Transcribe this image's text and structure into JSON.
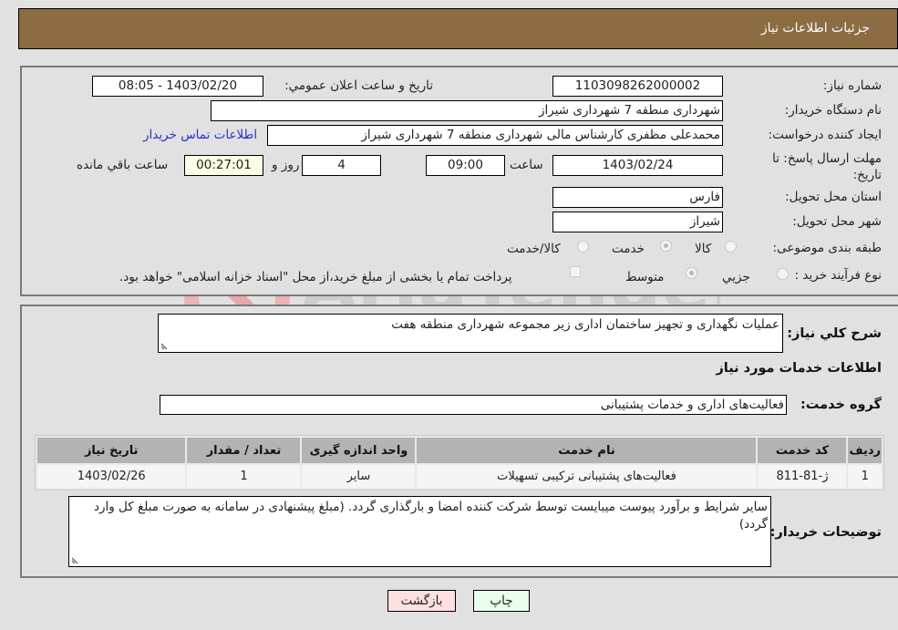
{
  "header": {
    "title": "جزئیات اطلاعات نیاز"
  },
  "fields": {
    "need_number": {
      "label": "شماره نیاز:",
      "value": "1103098262000002"
    },
    "announce_datetime": {
      "label": "تاریخ و ساعت اعلان عمومي:",
      "value": "1403/02/20 - 08:05"
    },
    "buyer_org": {
      "label": "نام دستگاه خريدار:",
      "value": "شهرداری منطقه 7 شهرداری شیراز"
    },
    "creator": {
      "label": "ایجاد کننده درخواست:",
      "value": "محمدعلی مظفری کارشناس مالی شهرداری منطقه 7 شهرداری شیراز"
    },
    "buyer_contact_link": "اطلاعات تماس خریدار",
    "deadline": {
      "label": "مهلت ارسال پاسخ: تا تاریخ:",
      "date": "1403/02/24",
      "time_label": "ساعت",
      "time": "09:00",
      "days": "4",
      "days_label": "روز و",
      "remaining": "00:27:01",
      "remaining_label": "ساعت باقي مانده"
    },
    "province": {
      "label": "استان محل تحویل:",
      "value": "فارس"
    },
    "city": {
      "label": "شهر محل تحویل:",
      "value": "شیراز"
    },
    "category": {
      "label": "طبقه بندی موضوعی:",
      "options": [
        "کالا",
        "خدمت",
        "کالا/خدمت"
      ],
      "selected": "خدمت"
    },
    "purchase_type": {
      "label": "نوع فرآیند خرید :",
      "options": [
        "جزيي",
        "متوسط"
      ],
      "selected": "متوسط",
      "treasury_note": "پرداخت تمام یا بخشی از مبلغ خرید،از محل \"اسناد خزانه اسلامی\" خواهد بود."
    }
  },
  "description": {
    "label": "شرح کلي نياز:",
    "value": "عملیات نگهداری و تجهیز ساختمان اداری زیر مجموعه شهرداری منطقه هفت"
  },
  "services_section_title": "اطلاعات خدمات مورد نیاز",
  "service_group": {
    "label": "گروه خدمت:",
    "value": "فعالیت‌های اداری و خدمات پشتیبانی"
  },
  "table": {
    "headers": [
      "ردیف",
      "کد خدمت",
      "نام خدمت",
      "واحد اندازه گیری",
      "تعداد / مقدار",
      "تاریخ نیاز"
    ],
    "rows": [
      [
        "1",
        "ژ-81-811",
        "فعالیت‌های پشتیبانی ترکیبی تسهیلات",
        "سایر",
        "1",
        "1403/02/26"
      ]
    ]
  },
  "buyer_notes": {
    "label": "توضیحات خریدار:",
    "value": "سایر شرایط و برآورد پیوست میبایست توسط شرکت کننده امضا و بارگذاری گردد. (مبلغ پیشنهادی در سامانه به صورت مبلغ کل وارد گردد)"
  },
  "buttons": {
    "print": "چاپ",
    "back": "بازگشت"
  },
  "watermark": {
    "text": "AriaTender.net"
  },
  "colors": {
    "header_bg": "#8c6c42",
    "back_button_bg": "#ffe0e0",
    "print_button_bg": "#eaffea",
    "link": "#2233cc"
  }
}
